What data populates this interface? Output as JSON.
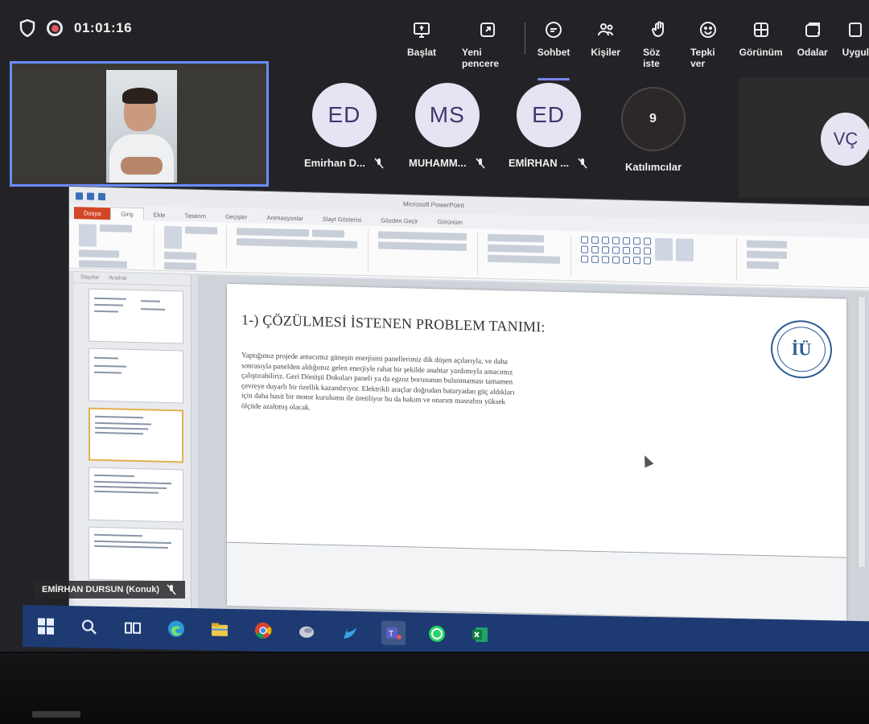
{
  "call": {
    "timer": "01:01:16"
  },
  "toolbar": {
    "items": [
      {
        "label": "Başlat",
        "icon": "share-screen-icon"
      },
      {
        "label": "Yeni pencere",
        "icon": "new-window-icon"
      },
      {
        "label": "Sohbet",
        "icon": "chat-icon"
      },
      {
        "label": "Kişiler",
        "icon": "people-icon"
      },
      {
        "label": "Söz iste",
        "icon": "raise-hand-icon"
      },
      {
        "label": "Tepki ver",
        "icon": "reaction-icon"
      },
      {
        "label": "Görünüm",
        "icon": "view-icon"
      },
      {
        "label": "Odalar",
        "icon": "rooms-icon"
      },
      {
        "label": "Uygul",
        "icon": "apps-icon"
      }
    ],
    "active": "Sohbet"
  },
  "participants": [
    {
      "initials": "ED",
      "name": "Emirhan D..."
    },
    {
      "initials": "MS",
      "name": "MUHAMM..."
    },
    {
      "initials": "ED",
      "name": "EMİRHAN ..."
    }
  ],
  "participants_count": {
    "value": "9",
    "label": "Katılımcılar"
  },
  "side_avatar": {
    "initials": "VÇ"
  },
  "presenter_label": "EMİRHAN DURSUN (Konuk)",
  "slide": {
    "title": "1-) ÇÖZÜLMESİ İSTENEN PROBLEM TANIMI:",
    "body": "Yaptığımız projede amacımız güneşin enerjisini panellerimiz dik düşen açılarıyla, ve daha sonrasıyla panelden aldığımız gelen enerjiyle rahat bir şekilde anahtar yardımıyla amacımız çalıştırabiliriz. Geri Dönüşü Dokuları paneli ya da egzoz borusunun bulunmaması tamamen çevreye duyarlı bir özellik kazandırıyor. Elektrikli araçlar doğrudan bataryadan güç aldıkları için daha basit bir motor kurulumu ile üretiliyor bu da bakım ve onarım masrafını yüksek ölçüde azaltmış olacak.",
    "logo_text": "İÜ"
  },
  "ppt": {
    "window_title": "Microsoft PowerPoint",
    "tabs": [
      "Dosya",
      "Giriş",
      "Ekle",
      "Tasarım",
      "Geçişler",
      "Animasyonlar",
      "Slayt Gösterisi",
      "Gözden Geçir",
      "Görünüm"
    ],
    "thumb_tabs": [
      "Slaytlar",
      "Anahat"
    ]
  },
  "taskbar": {
    "icons": [
      "windows-start-icon",
      "search-icon",
      "task-view-icon",
      "edge-icon",
      "file-explorer-icon",
      "chrome-icon",
      "app-icon",
      "store-icon",
      "teams-icon",
      "whatsapp-icon",
      "excel-icon"
    ]
  }
}
